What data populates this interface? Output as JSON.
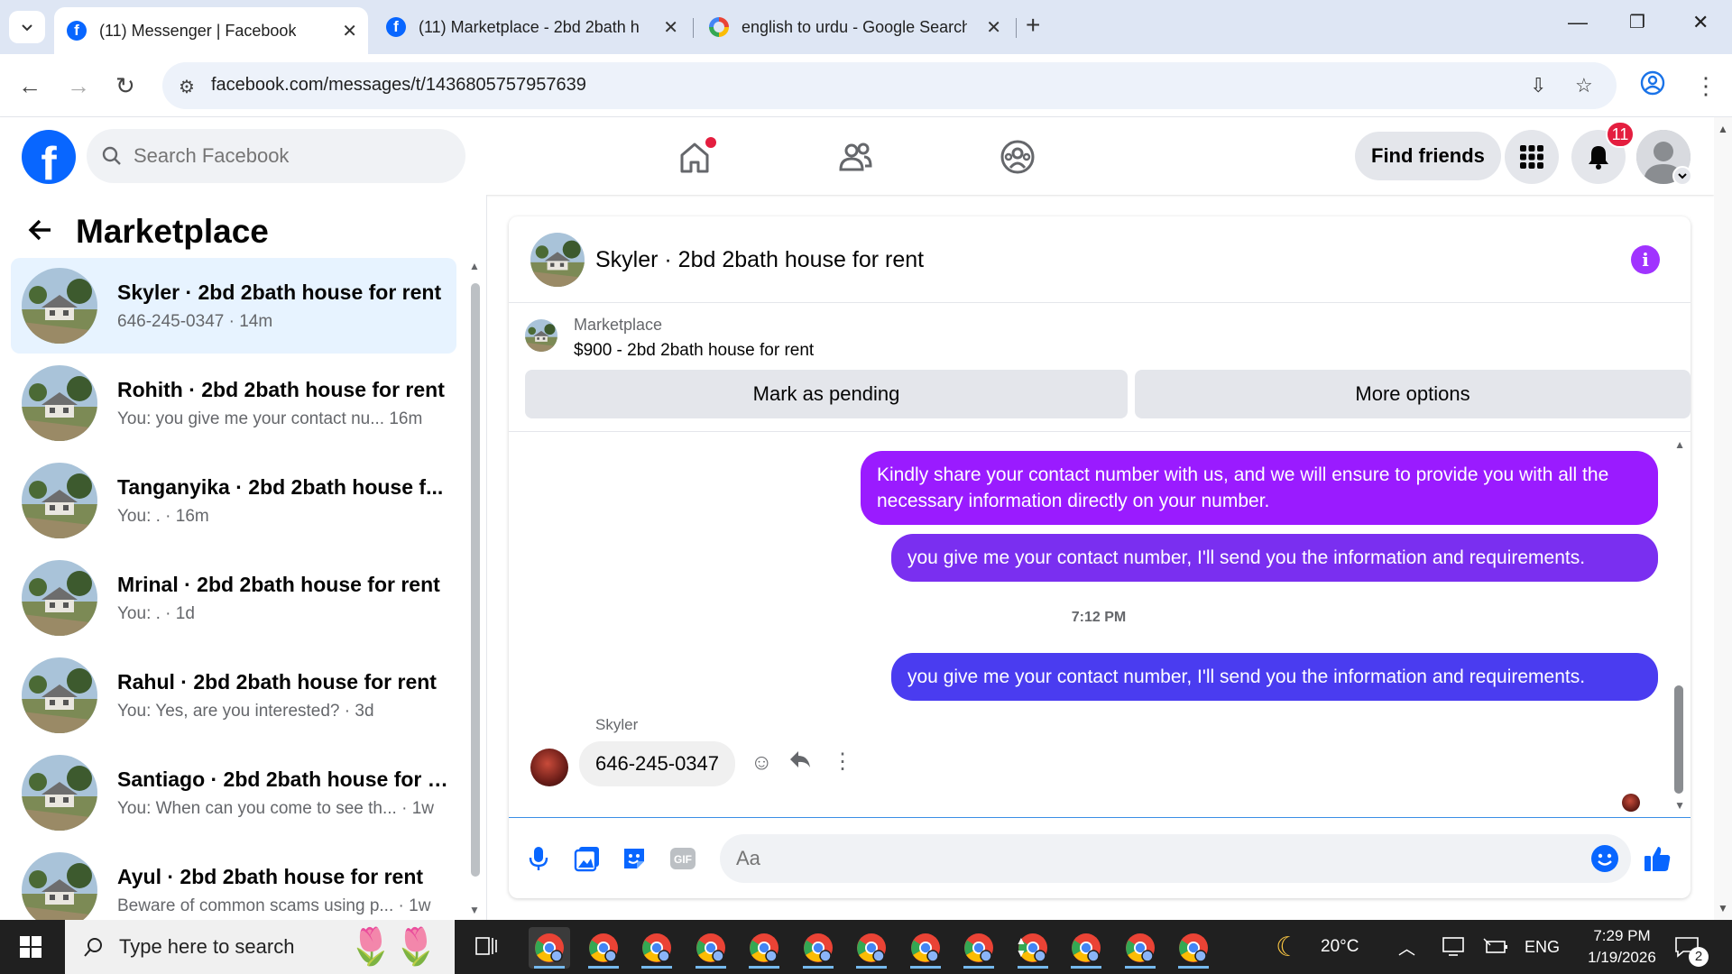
{
  "browser": {
    "tabs": [
      {
        "title": "(11) Messenger | Facebook",
        "icon": "facebook-icon"
      },
      {
        "title": "(11) Marketplace - 2bd 2bath h",
        "icon": "facebook-icon"
      },
      {
        "title": "english to urdu - Google Search",
        "icon": "google-icon"
      }
    ],
    "url": "facebook.com/messages/t/1436805757957639"
  },
  "fb": {
    "search_placeholder": "Search Facebook",
    "find_friends": "Find friends",
    "notification_count": "11"
  },
  "sidebar": {
    "title": "Marketplace",
    "conversations": [
      {
        "name": "Skyler · 2bd 2bath house for rent",
        "preview": "646-245-0347 · 14m"
      },
      {
        "name": "Rohith · 2bd 2bath house for rent",
        "preview": "You: you give me your contact nu...  16m"
      },
      {
        "name": "Tanganyika · 2bd 2bath house f...",
        "preview": "You: . · 16m"
      },
      {
        "name": "Mrinal · 2bd 2bath house for rent",
        "preview": "You: . · 1d"
      },
      {
        "name": "Rahul · 2bd 2bath house for rent",
        "preview": "You: Yes, are you interested? · 3d"
      },
      {
        "name": "Santiago · 2bd 2bath house for r...",
        "preview": "You: When can you come to see th... · 1w"
      },
      {
        "name": "Ayul · 2bd 2bath house for rent",
        "preview": "Beware of common scams using p... · 1w"
      }
    ]
  },
  "chat": {
    "title": "Skyler · 2bd 2bath house for rent",
    "listing_label": "Marketplace",
    "listing_price": "$900 - 2bd 2bath house for rent",
    "mark_pending": "Mark as pending",
    "more_options": "More options",
    "messages": [
      {
        "text": "Kindly share your contact number with us, and we will ensure to provide you with all the necessary information directly on your number."
      },
      {
        "text": "you give me your contact number, I'll send you the information and requirements."
      },
      {
        "text": "you give me your contact number, I'll send you the information and requirements."
      }
    ],
    "timestamp": "7:12 PM",
    "incoming_sender": "Skyler",
    "incoming_text": "646-245-0347",
    "composer_placeholder": "Aa",
    "colors": {
      "bubble_top": "#9a1bff",
      "bubble_mid": "#7a2ff0",
      "bubble_bottom": "#4a3cf0",
      "accent": "#0866ff"
    }
  },
  "taskbar": {
    "search_placeholder": "Type here to search",
    "temperature": "20°C",
    "language": "ENG",
    "time": "7:29 PM",
    "date": "1/19/2026",
    "notifications": "2"
  }
}
